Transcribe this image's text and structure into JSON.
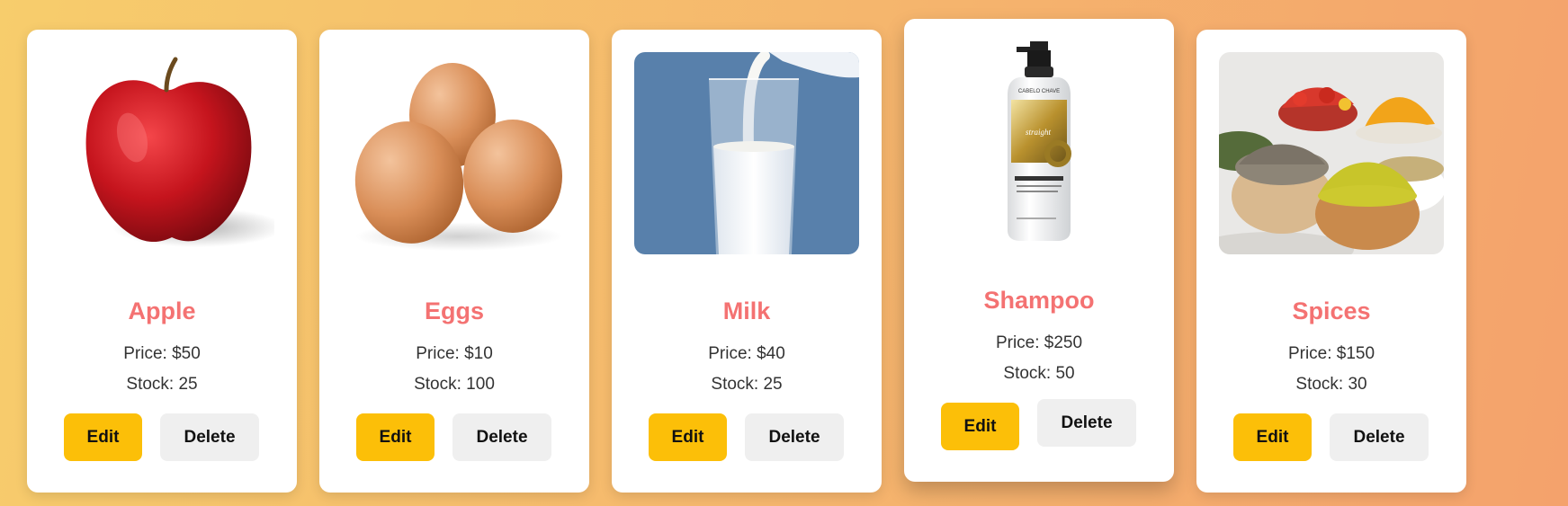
{
  "theme": {
    "accent": "#f47272",
    "edit_button_color": "#fcbf08",
    "delete_button_color": "#efefef"
  },
  "products": [
    {
      "name": "Apple",
      "price": "Price: $50",
      "stock": "Stock: 25",
      "image_icon": "apple-image",
      "edit_label": "Edit",
      "delete_label": "Delete"
    },
    {
      "name": "Eggs",
      "price": "Price: $10",
      "stock": "Stock: 100",
      "image_icon": "eggs-image",
      "edit_label": "Edit",
      "delete_label": "Delete"
    },
    {
      "name": "Milk",
      "price": "Price: $40",
      "stock": "Stock: 25",
      "image_icon": "milk-image",
      "edit_label": "Edit",
      "delete_label": "Delete"
    },
    {
      "name": "Shampoo",
      "price": "Price: $250",
      "stock": "Stock: 50",
      "image_icon": "shampoo-image",
      "edit_label": "Edit",
      "delete_label": "Delete",
      "image_text": [
        "CABELO CHAVE",
        "straight"
      ]
    },
    {
      "name": "Spices",
      "price": "Price: $150",
      "stock": "Stock: 30",
      "image_icon": "spices-image",
      "edit_label": "Edit",
      "delete_label": "Delete"
    }
  ]
}
